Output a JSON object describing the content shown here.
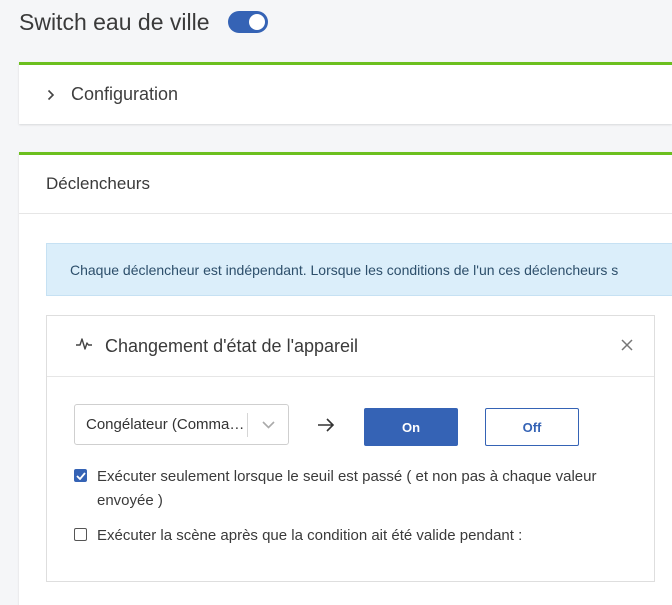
{
  "header": {
    "title": "Switch eau de ville",
    "toggle_on": true
  },
  "config_panel": {
    "label": "Configuration",
    "icon": "chevron-right-icon"
  },
  "triggers_panel": {
    "title": "Déclencheurs",
    "info": "Chaque déclencheur est indépendant. Lorsque les conditions de l'un ces déclencheurs s"
  },
  "trigger_card": {
    "title": "Changement d'état de l'appareil",
    "icon": "activity-icon",
    "device_select": "Congélateur (Commande)",
    "on_label": "On",
    "off_label": "Off",
    "option_threshold": {
      "label": "Exécuter seulement lorsque le seuil est passé ( et non pas à chaque valeur envoyée )",
      "checked": true
    },
    "option_duration": {
      "label": "Exécuter la scène après que la condition ait été valide pendant :",
      "checked": false
    }
  },
  "colors": {
    "accent": "#3563b5",
    "panel_border": "#6cbf1f",
    "info_bg": "#dbeefa"
  }
}
